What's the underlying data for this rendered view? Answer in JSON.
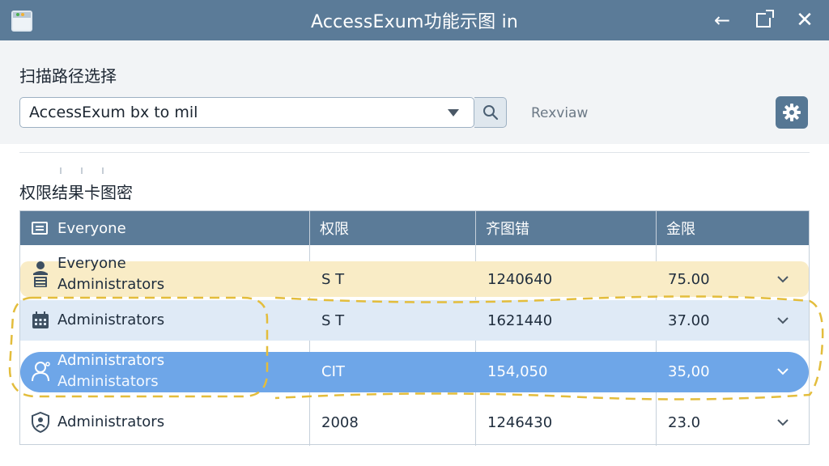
{
  "window": {
    "title": "AccessExum功能示图 in"
  },
  "scan": {
    "label": "扫描路径选择",
    "path_value": "AccessExum bx to mil",
    "review_label": "Rexviaw"
  },
  "results": {
    "section_title": "权限结果卡图密",
    "columns": [
      "Everyone",
      "权限",
      "齐图错",
      "金限"
    ],
    "rows": [
      {
        "name": "Everyone",
        "sub": "Administrators",
        "perm": "S T",
        "num": "1240640",
        "amt": "75.00",
        "icon": "user-icon"
      },
      {
        "name": "Administrators",
        "sub": "",
        "perm": "S T",
        "num": "1621440",
        "amt": "37.00",
        "icon": "calendar-icon"
      },
      {
        "name": "Administrators",
        "sub": "Administators",
        "perm": "CIT",
        "num": "154,050",
        "amt": "35,00",
        "icon": "person-outline-icon"
      },
      {
        "name": "Administrators",
        "sub": "",
        "perm": "2008",
        "num": "1246430",
        "amt": "23.0",
        "icon": "shield-icon"
      }
    ]
  },
  "colors": {
    "titlebar": "#5b7b98",
    "header": "#5b7b98",
    "row_yellow": "#f9ecc6",
    "row_light_blue": "#dfeaf6",
    "row_selected": "#6ea6e8",
    "dashed_highlight": "#e3bd3c"
  }
}
